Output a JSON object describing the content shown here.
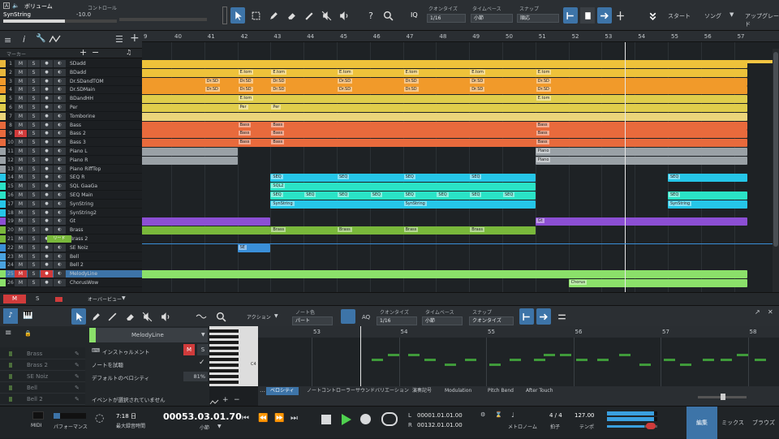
{
  "app": {
    "volume_label": "ボリューム",
    "track": "SynString",
    "volume_value": "-10.0",
    "control_label": "コントロール"
  },
  "toolbar": {
    "iq": "IQ",
    "quantize_label": "クオンタイズ",
    "quantize_value": "1/16",
    "timebase_label": "タイムベース",
    "timebase_value": "小節",
    "snap_label": "スナップ",
    "snap_value": "順応",
    "start": "スタート",
    "song": "ソング",
    "upgrade": "アップグレード"
  },
  "marker_label": "マーカー",
  "ruler": [
    "40",
    "41",
    "42",
    "43",
    "44",
    "45",
    "46",
    "47",
    "48",
    "49",
    "50",
    "51",
    "52",
    "53",
    "54",
    "55",
    "56",
    "57"
  ],
  "ruler_first": "9",
  "tracks": [
    {
      "n": "1",
      "name": "SDadd",
      "color": "#e9b73b"
    },
    {
      "n": "2",
      "name": "BDadd",
      "color": "#e9b73b"
    },
    {
      "n": "3",
      "name": "Dr.SDandTOM",
      "color": "#f19a2a"
    },
    {
      "n": "4",
      "name": "Dr.SDMain",
      "color": "#f19a2a"
    },
    {
      "n": "5",
      "name": "BDandHH",
      "color": "#e0cd4b"
    },
    {
      "n": "6",
      "name": "Per",
      "color": "#e0cd4b"
    },
    {
      "n": "7",
      "name": "Tomborine",
      "color": "#ebd57a"
    },
    {
      "n": "8",
      "name": "Bass",
      "color": "#e86a3c"
    },
    {
      "n": "9",
      "name": "Bass 2",
      "color": "#e86a3c"
    },
    {
      "n": "10",
      "name": "Bass 3",
      "color": "#e86a3c"
    },
    {
      "n": "11",
      "name": "Piano L",
      "color": "#9aa1a6"
    },
    {
      "n": "12",
      "name": "Piano R",
      "color": "#9aa1a6"
    },
    {
      "n": "13",
      "name": "Piano RiffTop",
      "color": "#9aa1a6"
    },
    {
      "n": "14",
      "name": "SEQ R",
      "color": "#25c6e8"
    },
    {
      "n": "15",
      "name": "SQL GaaGa",
      "color": "#2ae3c6"
    },
    {
      "n": "16",
      "name": "SEQ Main",
      "color": "#2ae3c6"
    },
    {
      "n": "17",
      "name": "SynString",
      "color": "#25c6e8"
    },
    {
      "n": "18",
      "name": "SynString2",
      "color": "#25c6e8"
    },
    {
      "n": "19",
      "name": "Gt",
      "color": "#8c4fd4"
    },
    {
      "n": "20",
      "name": "Brass",
      "color": "#79b83b"
    },
    {
      "n": "21",
      "name": "Brass 2",
      "color": "#79b83b"
    },
    {
      "n": "22",
      "name": "SE Noiz",
      "color": "#3a8fd8"
    },
    {
      "n": "23",
      "name": "Bell",
      "color": "#4aa3e0"
    },
    {
      "n": "24",
      "name": "Bell 2",
      "color": "#4aa3e0"
    },
    {
      "n": "25",
      "name": "MelodyLine",
      "color": "#8be06a"
    },
    {
      "n": "26",
      "name": "ChorusWow",
      "color": "#8be06a"
    }
  ],
  "track_btn": {
    "m": "M",
    "s": "S"
  },
  "brass2_tag": "リード",
  "clips": {
    "drsd": "Dr.SD",
    "etom": "E.tom",
    "per": "Per",
    "bass": "Bass",
    "piano": "Piano",
    "seq": "SEQ",
    "sql2": "SQL2",
    "synstring": "SynString",
    "gt": "Gt",
    "brass": "Brass",
    "se": "SE",
    "chorus": "Chorus"
  },
  "mid": {
    "m": "M",
    "s": "S",
    "overview": "オーバービュー"
  },
  "editor_toolbar": {
    "action": "アクション",
    "note_color_label": "ノート色",
    "note_color_value": "パート",
    "aq": "AQ",
    "quantize_label": "クオンタイズ",
    "quantize_value": "1/16",
    "timebase_label": "タイムベース",
    "timebase_value": "小節",
    "snap_label": "スナップ",
    "snap_value": "クオンタイズ"
  },
  "editor": {
    "track_name": "MelodyLine",
    "instrument": "インストゥルメント",
    "audition": "ノートを試聴",
    "default_vel_label": "デフォルトのベロシティ",
    "default_vel": "81%",
    "no_event": "イベントが選択されていません",
    "list": [
      "Brass",
      "Brass 2",
      "SE Noiz",
      "Bell",
      "Bell 2"
    ],
    "c4": "C4",
    "ruler": [
      "53",
      "54",
      "55",
      "56",
      "57",
      "58"
    ]
  },
  "lanes": [
    "ベロシティ",
    "ノートコントローラー",
    "サウンドバリエーション",
    "演奏記号",
    "Modulation",
    "Pitch Bend",
    "After Touch"
  ],
  "transport": {
    "midi": "MIDI",
    "perf": "パフォーマンス",
    "rec_time": "7:18 日",
    "rec_label": "最大録音時間",
    "position": "00053.03.01.70",
    "pos_unit": "小節",
    "l_val": "00001.01.01.00",
    "r_val": "00132.01.01.00",
    "l": "L",
    "r": "R",
    "metronome": "メトロノーム",
    "sig": "4 / 4",
    "sig_label": "拍子",
    "tempo": "127.00",
    "tempo_label": "テンポ",
    "edit": "編集",
    "mix": "ミックス",
    "browse": "ブラウズ"
  }
}
